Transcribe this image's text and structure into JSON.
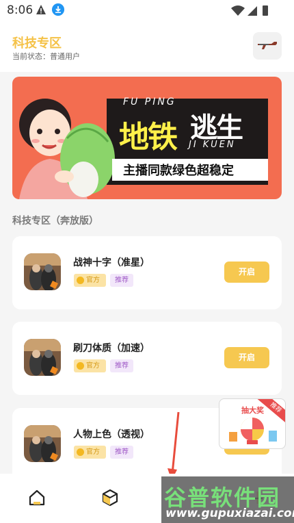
{
  "status_bar": {
    "time": "8:06"
  },
  "header": {
    "title": "科技专区",
    "subtitle": "当前状态：普通用户"
  },
  "banner": {
    "en_top": "FU PING",
    "title_part1": "地铁",
    "title_part2": "逃生",
    "en_bottom": "JI KUEN",
    "tagline": "主播同款绿色超稳定"
  },
  "section": {
    "title": "科技专区（奔放版）"
  },
  "items": [
    {
      "name": "战神十字（准星）",
      "tag_official": "官方",
      "tag_recommend": "推荐",
      "button": "开启"
    },
    {
      "name": "刷刀体质（加速）",
      "tag_official": "官方",
      "tag_recommend": "推荐",
      "button": "开启"
    },
    {
      "name": "人物上色（透视）",
      "tag_official": "官方",
      "tag_recommend": "推荐",
      "button": "开启"
    }
  ],
  "float_ad": {
    "title": "抽大奖",
    "corner": "推荐"
  },
  "watermark": {
    "text": "谷普软件园",
    "url": "www.gupuxiazai.com"
  },
  "colors": {
    "accent": "#f6c850",
    "title": "#f5c247",
    "banner_bg": "#f36d50"
  }
}
